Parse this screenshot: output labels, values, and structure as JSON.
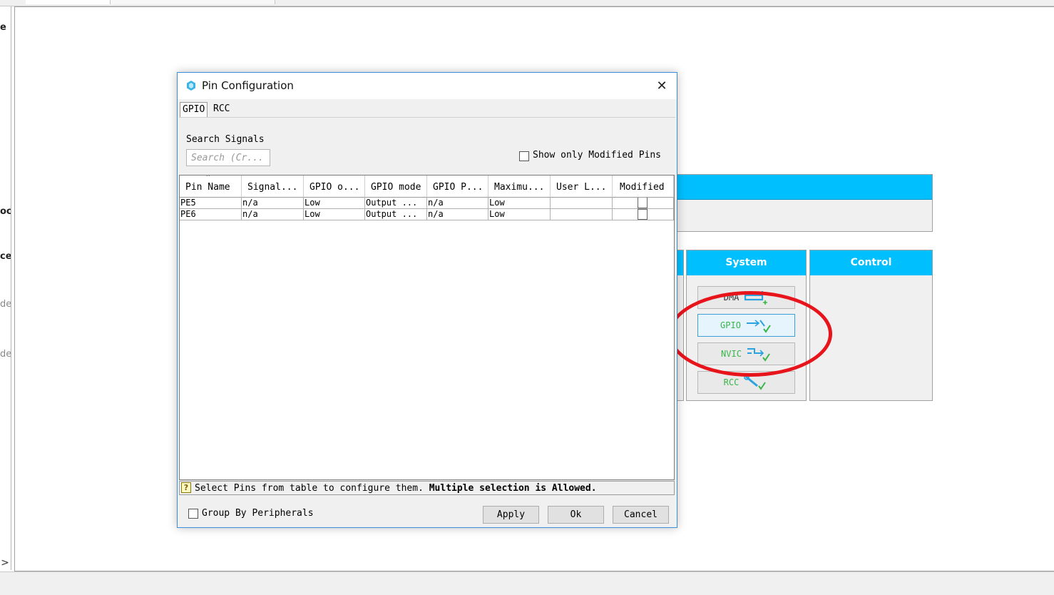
{
  "background": {
    "left_fragments": [
      "e",
      "ocl",
      "ce",
      "de",
      "de"
    ],
    "scroll_arrow": ">",
    "categories": [
      {
        "name": "system",
        "title": "System",
        "items": [
          {
            "label": "DMA",
            "icon": "dma-icon",
            "state": "default"
          },
          {
            "label": "GPIO",
            "icon": "gpio-icon",
            "state": "selected"
          },
          {
            "label": "NVIC",
            "icon": "nvic-icon",
            "state": "configured"
          },
          {
            "label": "RCC",
            "icon": "rcc-icon",
            "state": "configured"
          }
        ]
      },
      {
        "name": "control",
        "title": "Control",
        "items": []
      }
    ],
    "header_color": "#00bfff",
    "highlight_color": "#e8141b"
  },
  "dialog": {
    "title": "Pin Configuration",
    "close_glyph": "✕",
    "tabs": [
      {
        "label": "GPIO",
        "active": true
      },
      {
        "label": "RCC",
        "active": false
      }
    ],
    "search": {
      "label": "Search Signals",
      "placeholder": "Search (Cr..."
    },
    "show_modified_label": "Show only Modified Pins",
    "show_modified_checked": false,
    "table": {
      "columns": [
        "Pin Name",
        "Signal...",
        "GPIO o...",
        "GPIO mode",
        "GPIO P...",
        "Maximu...",
        "User L...",
        "Modified"
      ],
      "sort_indicator": "^",
      "rows": [
        {
          "pin": "PE5",
          "signal": "n/a",
          "gpio_output": "Low",
          "gpio_mode": "Output ...",
          "gpio_pull": "n/a",
          "max_speed": "Low",
          "user_label": "",
          "modified": false
        },
        {
          "pin": "PE6",
          "signal": "n/a",
          "gpio_output": "Low",
          "gpio_mode": "Output ...",
          "gpio_pull": "n/a",
          "max_speed": "Low",
          "user_label": "",
          "modified": false
        }
      ]
    },
    "hint": {
      "icon": "?",
      "text": "Select Pins from table to configure them.",
      "bold": "Multiple selection is Allowed."
    },
    "group_by_label": "Group By Peripherals",
    "group_by_checked": false,
    "buttons": {
      "apply": "Apply",
      "ok": "Ok",
      "cancel": "Cancel"
    },
    "accent_color": "#3c8ed8"
  }
}
